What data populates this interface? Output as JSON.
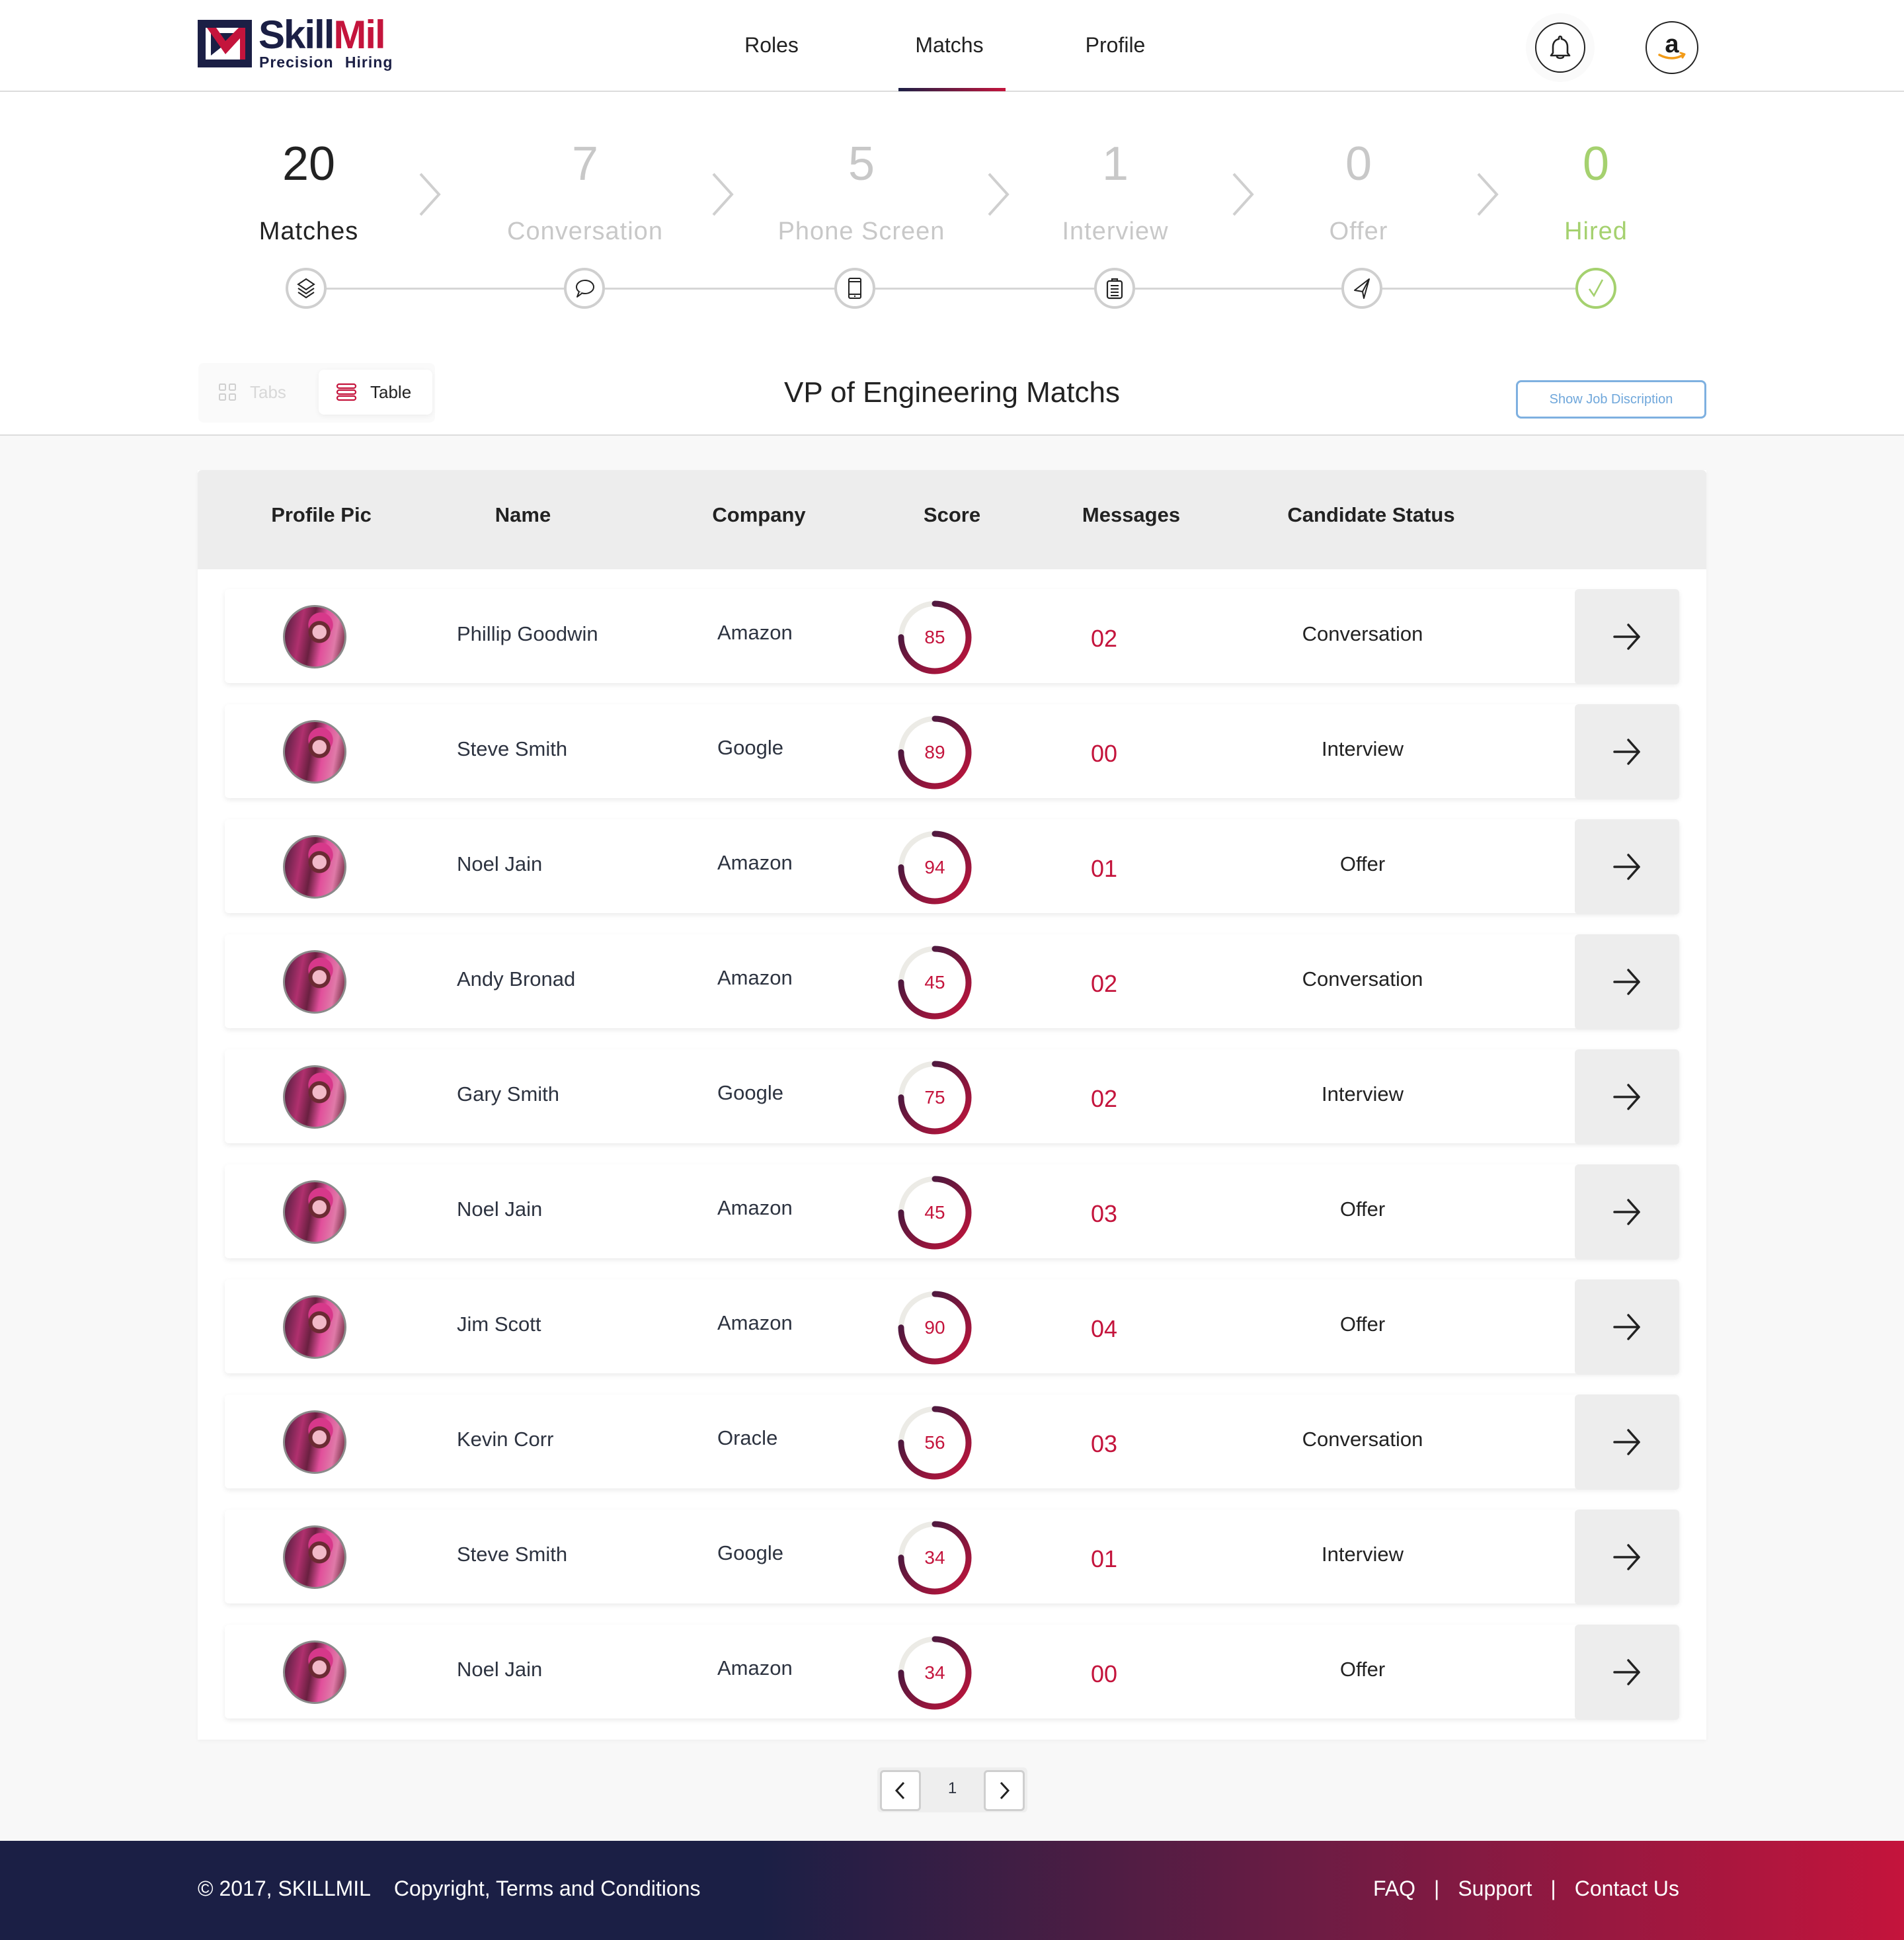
{
  "brand": {
    "name_part1": "Skill",
    "name_part2": "Mil",
    "tagline": "Precision Hiring",
    "colors": {
      "navy": "#1b1f45",
      "crimson": "#c4143c",
      "green": "#a5d16f",
      "link_blue": "#6fa7db"
    }
  },
  "nav": {
    "items": [
      {
        "label": "Roles",
        "active": false
      },
      {
        "label": "Matchs",
        "active": true
      },
      {
        "label": "Profile",
        "active": false
      }
    ],
    "notification_icon": "bell-icon",
    "account_icon": "amazon-logo"
  },
  "pipeline": {
    "stages": [
      {
        "count": "20",
        "label": "Matches",
        "icon": "layers-icon",
        "state": "active"
      },
      {
        "count": "7",
        "label": "Conversation",
        "icon": "chat-bubble-icon",
        "state": "inactive"
      },
      {
        "count": "5",
        "label": "Phone Screen",
        "icon": "phone-icon",
        "state": "inactive"
      },
      {
        "count": "1",
        "label": "Interview",
        "icon": "clipboard-icon",
        "state": "inactive"
      },
      {
        "count": "0",
        "label": "Offer",
        "icon": "paper-plane-icon",
        "state": "inactive"
      },
      {
        "count": "0",
        "label": "Hired",
        "icon": "check-icon",
        "state": "hired"
      }
    ]
  },
  "toolbar": {
    "view_tabs": [
      {
        "label": "Tabs",
        "icon": "grid-icon",
        "active": false
      },
      {
        "label": "Table",
        "icon": "list-icon",
        "active": true
      }
    ],
    "title": "VP of Engineering Matchs",
    "job_description_button": "Show Job Discription"
  },
  "table": {
    "columns": [
      "Profile Pic",
      "Name",
      "Company",
      "Score",
      "Messages",
      "Candidate Status"
    ],
    "rows": [
      {
        "name": "Phillip Goodwin",
        "company": "Amazon",
        "score": "85",
        "messages": "02",
        "status": "Conversation"
      },
      {
        "name": "Steve Smith",
        "company": "Google",
        "score": "89",
        "messages": "00",
        "status": "Interview"
      },
      {
        "name": "Noel Jain",
        "company": "Amazon",
        "score": "94",
        "messages": "01",
        "status": "Offer"
      },
      {
        "name": "Andy Bronad",
        "company": "Amazon",
        "score": "45",
        "messages": "02",
        "status": "Conversation"
      },
      {
        "name": "Gary Smith",
        "company": "Google",
        "score": "75",
        "messages": "02",
        "status": "Interview"
      },
      {
        "name": "Noel Jain",
        "company": "Amazon",
        "score": "45",
        "messages": "03",
        "status": "Offer"
      },
      {
        "name": "Jim Scott",
        "company": "Amazon",
        "score": "90",
        "messages": "04",
        "status": "Offer"
      },
      {
        "name": "Kevin Corr",
        "company": "Oracle",
        "score": "56",
        "messages": "03",
        "status": "Conversation"
      },
      {
        "name": "Steve Smith",
        "company": "Google",
        "score": "34",
        "messages": "01",
        "status": "Interview"
      },
      {
        "name": "Noel Jain",
        "company": "Amazon",
        "score": "34",
        "messages": "00",
        "status": "Offer"
      }
    ],
    "score_ring_fill": 0.75,
    "row_action_icon": "arrow-right-icon"
  },
  "pagination": {
    "current_page": "1",
    "prev_icon": "chevron-left-icon",
    "next_icon": "chevron-right-icon"
  },
  "footer": {
    "copyright": "© 2017, SKILLMIL",
    "terms": "Copyright, Terms and Conditions",
    "links": [
      "FAQ",
      "Support",
      "Contact Us"
    ],
    "separator": "|"
  }
}
